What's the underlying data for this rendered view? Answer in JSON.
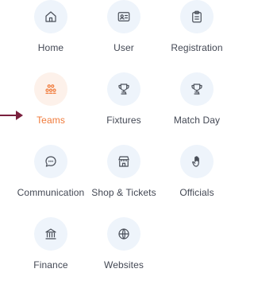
{
  "menu": {
    "items": [
      {
        "label": "Home",
        "icon": "home-icon"
      },
      {
        "label": "User",
        "icon": "id-card-icon"
      },
      {
        "label": "Registration",
        "icon": "clipboard-icon"
      },
      {
        "label": "Teams",
        "icon": "teams-icon",
        "active": true
      },
      {
        "label": "Fixtures",
        "icon": "trophy-icon"
      },
      {
        "label": "Match Day",
        "icon": "trophy-icon"
      },
      {
        "label": "Communication",
        "icon": "chat-bubble-icon"
      },
      {
        "label": "Shop & Tickets",
        "icon": "store-icon"
      },
      {
        "label": "Officials",
        "icon": "hand-icon"
      },
      {
        "label": "Finance",
        "icon": "bank-icon"
      },
      {
        "label": "Websites",
        "icon": "globe-icon"
      }
    ]
  },
  "colors": {
    "active": "#f07a3a",
    "icon_bg": "#eef4fb",
    "active_icon_bg": "#fdf1ea",
    "text": "#434854",
    "arrow": "#7a1f3d"
  }
}
